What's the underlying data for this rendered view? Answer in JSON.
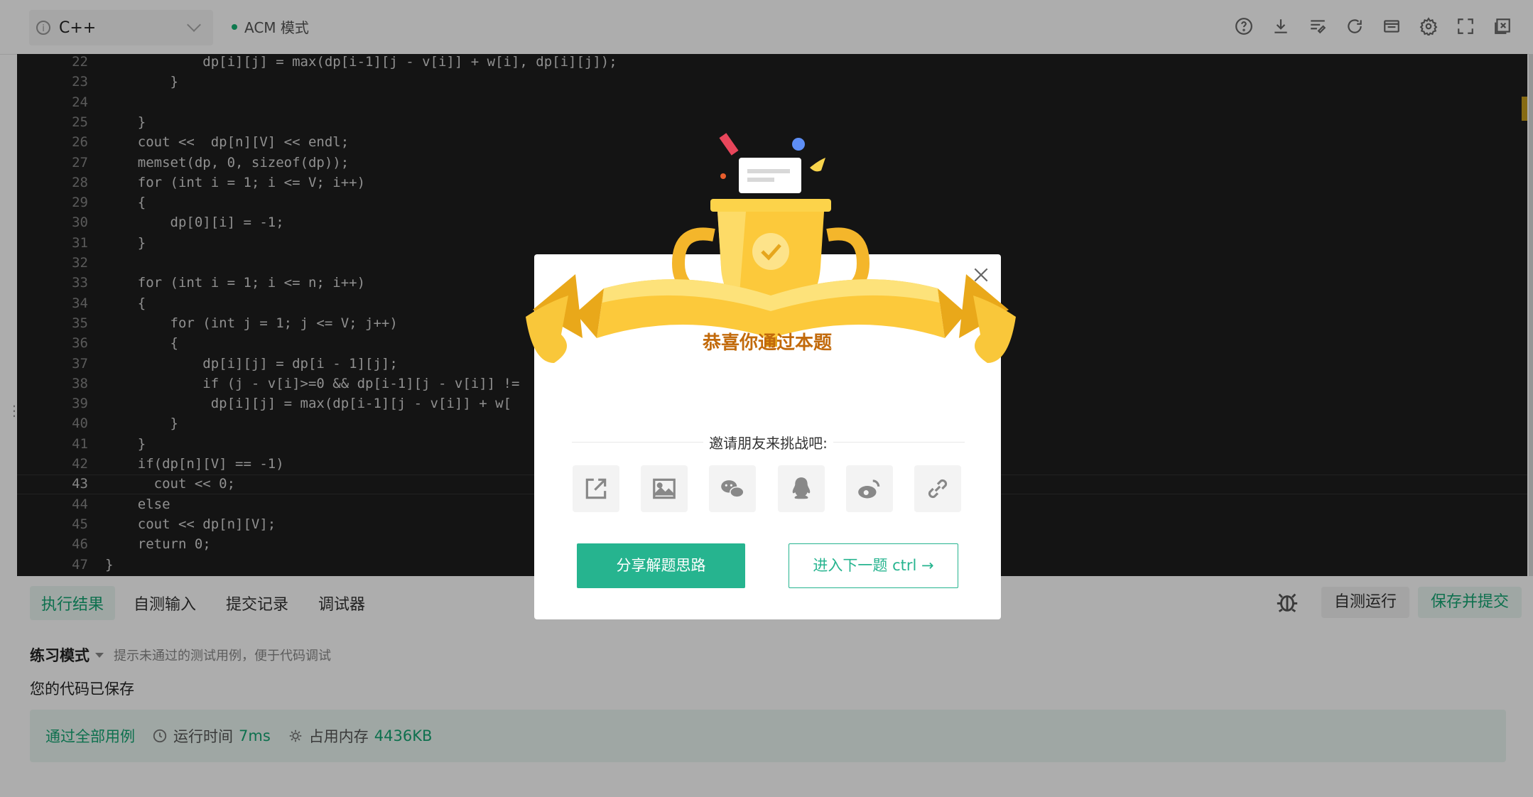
{
  "toolbar": {
    "language": "C++",
    "mode": "ACM 模式",
    "icons": [
      "help-icon",
      "download-icon",
      "format-icon",
      "reset-icon",
      "terminal-icon",
      "settings-icon",
      "fullscreen-icon",
      "close-window-icon"
    ]
  },
  "editor": {
    "current_line": 43,
    "lines": [
      {
        "n": "22",
        "code": "            dp[i][j] = max(dp[i-1][j - v[i]] + w[i], dp[i][j]);"
      },
      {
        "n": "23",
        "code": "        }"
      },
      {
        "n": "24",
        "code": ""
      },
      {
        "n": "25",
        "code": "    }"
      },
      {
        "n": "26",
        "code": "    cout <<  dp[n][V] << endl;"
      },
      {
        "n": "27",
        "code": "    memset(dp, 0, sizeof(dp));"
      },
      {
        "n": "28",
        "code": "    for (int i = 1; i <= V; i++)"
      },
      {
        "n": "29",
        "code": "    {"
      },
      {
        "n": "30",
        "code": "        dp[0][i] = -1;"
      },
      {
        "n": "31",
        "code": "    }"
      },
      {
        "n": "32",
        "code": ""
      },
      {
        "n": "33",
        "code": "    for (int i = 1; i <= n; i++)"
      },
      {
        "n": "34",
        "code": "    {"
      },
      {
        "n": "35",
        "code": "        for (int j = 1; j <= V; j++)"
      },
      {
        "n": "36",
        "code": "        {"
      },
      {
        "n": "37",
        "code": "            dp[i][j] = dp[i - 1][j];"
      },
      {
        "n": "38",
        "code": "            if (j - v[i]>=0 && dp[i-1][j - v[i]] !="
      },
      {
        "n": "39",
        "code": "             dp[i][j] = max(dp[i-1][j - v[i]] + w["
      },
      {
        "n": "40",
        "code": "        }"
      },
      {
        "n": "41",
        "code": "    }"
      },
      {
        "n": "42",
        "code": "    if(dp[n][V] == -1)"
      },
      {
        "n": "43",
        "code": "      cout << 0;"
      },
      {
        "n": "44",
        "code": "    else"
      },
      {
        "n": "45",
        "code": "    cout << dp[n][V];"
      },
      {
        "n": "46",
        "code": "    return 0;"
      },
      {
        "n": "47",
        "code": "}"
      }
    ]
  },
  "bottom": {
    "tabs": [
      "执行结果",
      "自测输入",
      "提交记录",
      "调试器"
    ],
    "active_tab": "执行结果",
    "self_run": "自测运行",
    "submit": "保存并提交",
    "practice_mode": "练习模式",
    "practice_hint": "提示未通过的测试用例，便于代码调试",
    "saved_msg": "您的代码已保存",
    "result": {
      "pass_all": "通过全部用例",
      "runtime_label": "运行时间",
      "runtime_value": "7ms",
      "memory_label": "占用内存",
      "memory_value": "4436KB"
    }
  },
  "modal": {
    "title": "恭喜你通过本题",
    "invite": "邀请朋友来挑战吧:",
    "share_icons": [
      "share-external-icon",
      "image-icon",
      "wechat-icon",
      "qq-icon",
      "weibo-icon",
      "link-icon"
    ],
    "btn_share": "分享解题思路",
    "btn_next": "进入下一题 ctrl →"
  },
  "colors": {
    "accent": "#26b48f",
    "accent_text": "#15a673",
    "trophy_gold": "#fcc93b",
    "title_orange": "#c26a0b"
  }
}
